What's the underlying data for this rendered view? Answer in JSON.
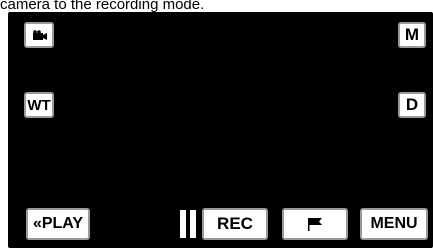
{
  "caption": "camera to the recording mode.",
  "top_left": {
    "icon": "video-camera-icon"
  },
  "top_right": {
    "label": "M"
  },
  "mid_left": {
    "label": "WT"
  },
  "mid_right": {
    "label": "D"
  },
  "bottom": {
    "play_label": "«PLAY",
    "pause_icon": "pause-icon",
    "rec_label": "REC",
    "flag_icon": "flag-icon",
    "menu_label": "MENU"
  }
}
